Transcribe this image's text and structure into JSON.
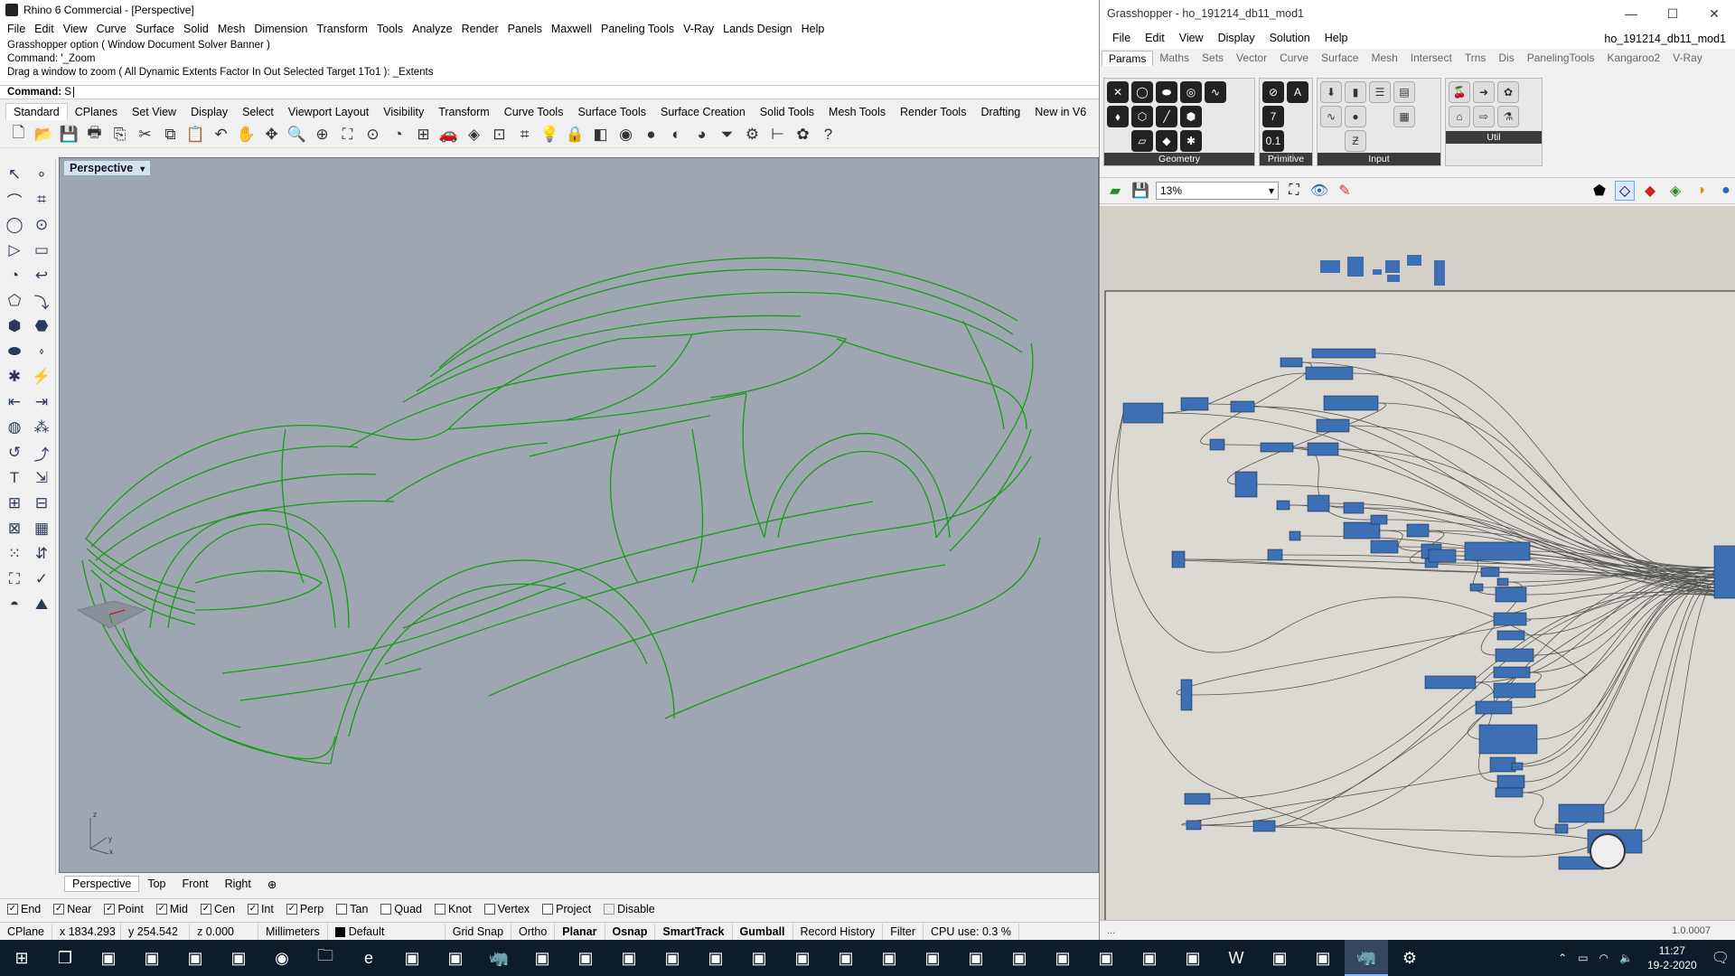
{
  "rhino": {
    "title": "Rhino 6 Commercial - [Perspective]",
    "menu": [
      "File",
      "Edit",
      "View",
      "Curve",
      "Surface",
      "Solid",
      "Mesh",
      "Dimension",
      "Transform",
      "Tools",
      "Analyze",
      "Render",
      "Panels",
      "Maxwell",
      "Paneling Tools",
      "V-Ray",
      "Lands Design",
      "Help"
    ],
    "command_history": [
      "Grasshopper option ( Window  Document  Solver  Banner )",
      "Command: '_Zoom",
      "Drag a window to zoom ( All  Dynamic  Extents  Factor  In  Out  Selected  Target  1To1 ): _Extents"
    ],
    "command_prompt": "Command:",
    "command_input": "S",
    "toolbar_tabs": [
      "Standard",
      "CPlanes",
      "Set View",
      "Display",
      "Select",
      "Viewport Layout",
      "Visibility",
      "Transform",
      "Curve Tools",
      "Surface Tools",
      "Surface Creation",
      "Solid Tools",
      "Mesh Tools",
      "Render Tools",
      "Drafting",
      "New in V6"
    ],
    "main_tools": [
      "new-icon",
      "open-icon",
      "save-icon",
      "print-icon",
      "import-icon",
      "cut-icon",
      "copy-icon",
      "paste-icon",
      "undo-icon",
      "pan-icon",
      "rotate-view-icon",
      "zoom-icon",
      "zoom-window-icon",
      "zoom-extents-icon",
      "zoom-selected-icon",
      "named-view-icon",
      "viewport-layout-icon",
      "car-icon",
      "snapshot-icon",
      "cplane-icon",
      "grid-icon",
      "light-icon",
      "lock-icon",
      "layers-icon",
      "color-wheel-icon",
      "shaded-sphere-icon",
      "render-sphere-icon",
      "material-sphere-icon",
      "filter-icon",
      "gear-icon",
      "dimension-icon",
      "grasshopper-icon",
      "help-icon"
    ],
    "viewport_label": "Perspective",
    "viewport_tabs": [
      "Perspective",
      "Top",
      "Front",
      "Right"
    ],
    "osnaps": [
      {
        "label": "End",
        "on": true
      },
      {
        "label": "Near",
        "on": true
      },
      {
        "label": "Point",
        "on": true
      },
      {
        "label": "Mid",
        "on": true
      },
      {
        "label": "Cen",
        "on": true
      },
      {
        "label": "Int",
        "on": true
      },
      {
        "label": "Perp",
        "on": true
      },
      {
        "label": "Tan",
        "on": false
      },
      {
        "label": "Quad",
        "on": false
      },
      {
        "label": "Knot",
        "on": false
      },
      {
        "label": "Vertex",
        "on": false
      },
      {
        "label": "Project",
        "on": false
      },
      {
        "label": "Disable",
        "on": false
      }
    ],
    "status": {
      "cplane": "CPlane",
      "x": "x 1834.293",
      "y": "y 254.542",
      "z": "z 0.000",
      "units": "Millimeters",
      "layer": "Default",
      "grid_snap": "Grid Snap",
      "ortho": "Ortho",
      "planar": "Planar",
      "osnap": "Osnap",
      "smarttrack": "SmartTrack",
      "gumball": "Gumball",
      "record_history": "Record History",
      "filter": "Filter",
      "cpu": "CPU use: 0.3 %"
    },
    "wire_color": "#1a9a1a"
  },
  "grasshopper": {
    "title": "Grasshopper - ho_191214_db11_mod1",
    "menu": [
      "File",
      "Edit",
      "View",
      "Display",
      "Solution",
      "Help"
    ],
    "document_name": "ho_191214_db11_mod1",
    "tabs": [
      "Params",
      "Maths",
      "Sets",
      "Vector",
      "Curve",
      "Surface",
      "Mesh",
      "Intersect",
      "Trns",
      "Dis",
      "PanelingTools",
      "Kangaroo2",
      "V-Ray"
    ],
    "ribbon_groups": [
      "Geometry",
      "Primitive",
      "Input",
      "Util"
    ],
    "zoom": "13%",
    "version": "1.0.0007",
    "status_left": "...",
    "canvas_color": "#d4d0c8",
    "node_color": "#3c6fb4"
  },
  "taskbar": {
    "apps": [
      "windows-start-icon",
      "task-view-icon",
      "app-pen-icon",
      "app-media-icon",
      "app-office-icon",
      "app-d-icon",
      "chrome-icon",
      "file-explorer-icon",
      "edge-icon",
      "app-red-icon",
      "app-globe-icon",
      "rhino-icon",
      "app-terminal-icon",
      "app-green-icon",
      "app-purple-icon",
      "app-dark-icon",
      "app-camera-icon",
      "app-print-icon",
      "app-box-icon",
      "app-chart-icon",
      "app-x-icon",
      "app-wheel-icon",
      "app-grid-icon",
      "app-save-icon",
      "app-mkv-icon",
      "app-vs-icon",
      "app-p-icon",
      "app-red2-icon",
      "word-icon",
      "app-calc-icon",
      "app-diamond-icon",
      "rhino6-icon",
      "settings-icon"
    ],
    "time": "11:27",
    "date": "19-2-2020"
  }
}
